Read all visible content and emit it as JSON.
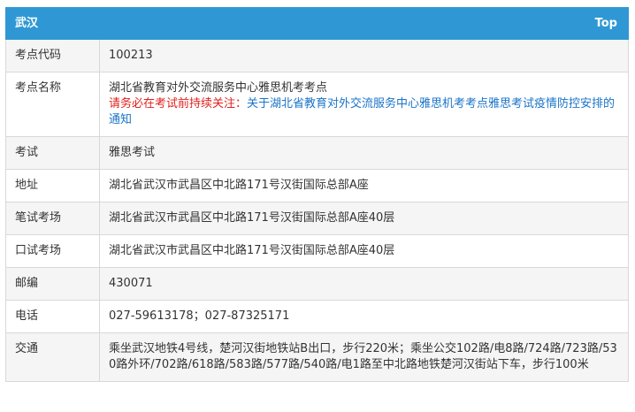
{
  "header": {
    "city": "武汉",
    "top_link": "Top"
  },
  "rows": {
    "code": {
      "label": "考点代码",
      "value": "100213"
    },
    "name": {
      "label": "考点名称",
      "value": "湖北省教育对外交流服务中心雅思机考考点",
      "warning": "请务必在考试前持续关注：",
      "notice_link": "关于湖北省教育对外交流服务中心雅思机考考点雅思考试疫情防控安排的通知"
    },
    "exam": {
      "label": "考试",
      "value": "雅思考试"
    },
    "address": {
      "label": "地址",
      "value": "湖北省武汉市武昌区中北路171号汉街国际总部A座"
    },
    "written": {
      "label": "笔试考场",
      "value": "湖北省武汉市武昌区中北路171号汉街国际总部A座40层"
    },
    "oral": {
      "label": "口试考场",
      "value": "湖北省武汉市武昌区中北路171号汉街国际总部A座40层"
    },
    "postcode": {
      "label": "邮编",
      "value": "430071"
    },
    "phone": {
      "label": "电话",
      "value": "027-59613178；027-87325171"
    },
    "transport": {
      "label": "交通",
      "value": "乘坐武汉地铁4号线，楚河汉街地铁站B出口，步行220米；乘坐公交102路/电8路/724路/723路/530路外环/702路/618路/583路/577路/540路/电1路至中北路地铁楚河汉街站下车，步行100米"
    }
  }
}
